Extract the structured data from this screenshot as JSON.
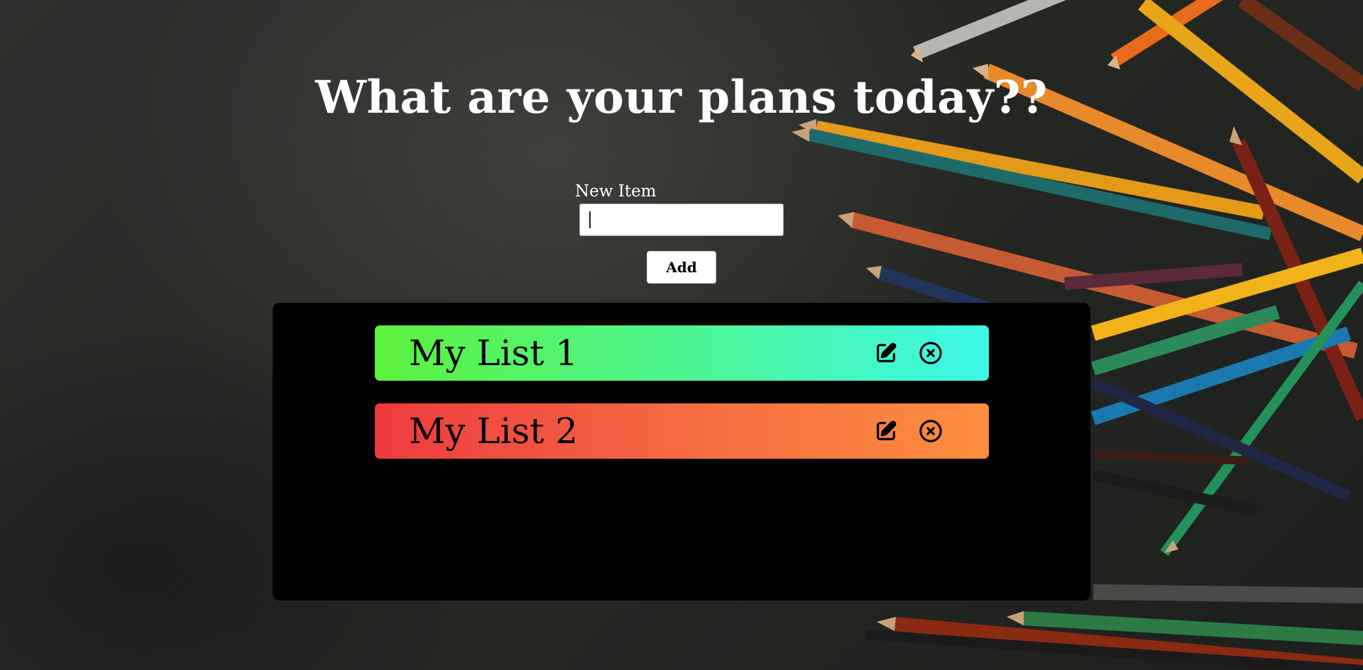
{
  "header": {
    "title": "What are your plans today??"
  },
  "form": {
    "label": "New Item",
    "input_value": "",
    "input_placeholder": "",
    "add_label": "Add"
  },
  "lists": [
    {
      "title": "My List 1",
      "edit_icon": "edit-icon",
      "delete_icon": "close-circle-icon",
      "colors": [
        "#5cf23c",
        "#3df8e8"
      ]
    },
    {
      "title": "My List 2",
      "edit_icon": "edit-icon",
      "delete_icon": "close-circle-icon",
      "colors": [
        "#ee3a3f",
        "#fc8e3e"
      ]
    }
  ],
  "background": {
    "image": "colored-pencils-on-dark-surface",
    "base_color": "#262824"
  }
}
